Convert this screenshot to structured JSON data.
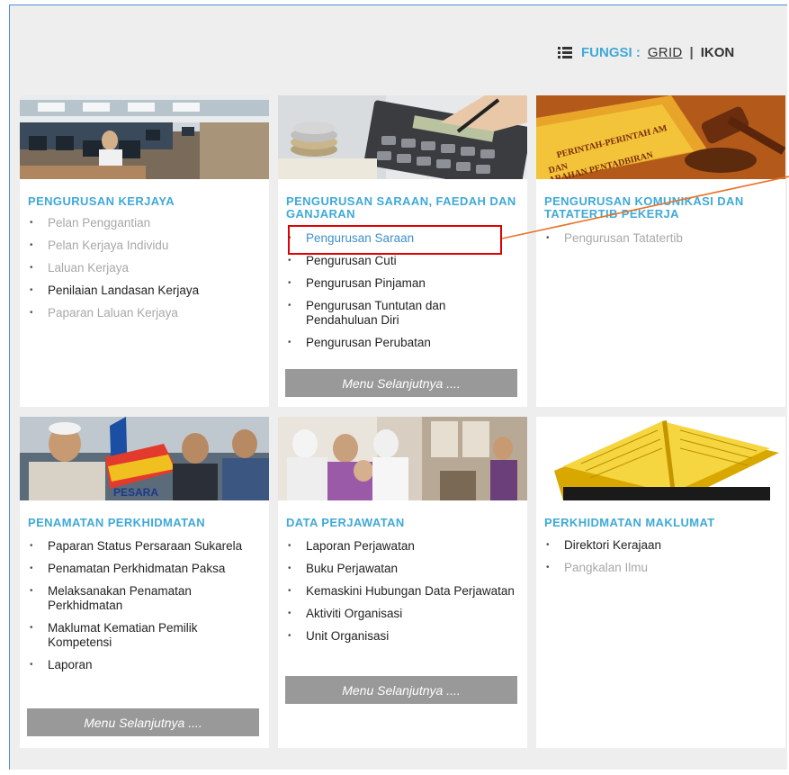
{
  "toolbar": {
    "fungsi_label": "FUNGSI :",
    "grid_label": "GRID",
    "separator": "|",
    "ikon_label": "IKON"
  },
  "cards": [
    {
      "title": "PENGURUSAN KERJAYA",
      "items": [
        "Pelan Penggantian",
        "Pelan Kerjaya Individu",
        "Laluan Kerjaya",
        "Penilaian Landasan Kerjaya",
        "Paparan Laluan Kerjaya"
      ]
    },
    {
      "title": "PENGURUSAN SARAAN, FAEDAH DAN GANJARAN",
      "items": [
        "Pengurusan Saraan",
        "Pengurusan Cuti",
        "Pengurusan Pinjaman",
        "Pengurusan Tuntutan dan Pendahuluan Diri",
        "Pengurusan Perubatan"
      ],
      "button": "Menu Selanjutnya ...."
    },
    {
      "title": "PENGURUSAN KOMUNIKASI DAN TATATERTIB PEKERJA",
      "items": [
        "Pengurusan Tatatertib"
      ],
      "photo_text": [
        "PERINTAH-PERINTAH AM",
        "DAN",
        "ARAHAN PENTADBIRAN"
      ]
    },
    {
      "title": "PENAMATAN PERKHIDMATAN",
      "items": [
        "Paparan Status Persaraan Sukarela",
        "Penamatan Perkhidmatan Paksa",
        "Melaksanakan Penamatan Perkhidmatan",
        "Maklumat Kematian Pemilik Kompetensi",
        "Laporan"
      ],
      "button": "Menu Selanjutnya ....",
      "photo_text": "PESARA"
    },
    {
      "title": "DATA PERJAWATAN",
      "items": [
        "Laporan Perjawatan",
        "Buku Perjawatan",
        "Kemaskini Hubungan Data Perjawatan",
        "Aktiviti Organisasi",
        "Unit Organisasi"
      ],
      "button": "Menu Selanjutnya ...."
    },
    {
      "title": "PERKHIDMATAN MAKLUMAT",
      "items": [
        "Direktori Kerajaan",
        "Pangkalan Ilmu"
      ]
    }
  ],
  "colors": {
    "accent": "#3fa9d8",
    "muted": "#a8a8a8",
    "button": "#999999",
    "highlight": "#e00000",
    "callout": "#e8732a"
  }
}
